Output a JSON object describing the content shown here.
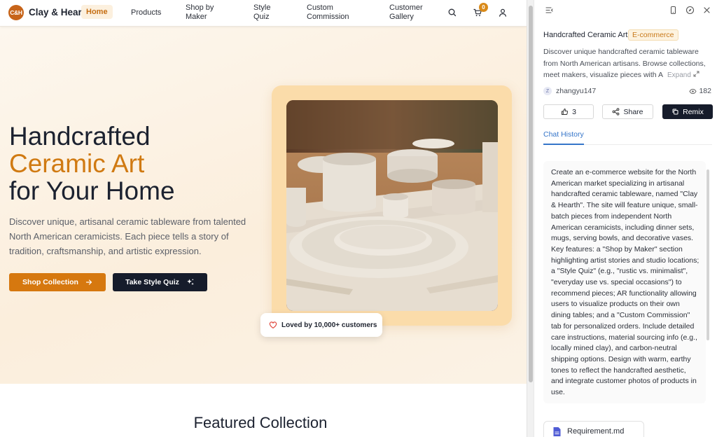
{
  "site": {
    "logo_badge": "C&H",
    "logo_text": "Clay & Hearth",
    "nav": {
      "home": "Home",
      "products": "Products",
      "shop_by_maker": "Shop by Maker",
      "style_quiz": "Style Quiz",
      "custom_commission": "Custom Commission",
      "customer_gallery": "Customer Gallery",
      "cart_count": "0"
    },
    "hero": {
      "title_line1": "Handcrafted",
      "title_line2": "Ceramic Art",
      "title_line3": "for Your Home",
      "description": "Discover unique, artisanal ceramic tableware from talented North American ceramicists. Each piece tells a story of tradition, craftsmanship, and artistic expression.",
      "shop_button": "Shop Collection",
      "quiz_button": "Take Style Quiz",
      "loved_badge": "Loved by 10,000+ customers"
    },
    "featured_title": "Featured Collection"
  },
  "panel": {
    "title": "Handcrafted Ceramic Art",
    "tag": "E-commerce",
    "description": "Discover unique handcrafted ceramic tableware from North American artisans. Browse collections, meet makers, visualize pieces with A ...",
    "expand_label": "Expand",
    "author_initial": "Z",
    "author": "zhangyu147",
    "views": "182",
    "likes": "3",
    "share_label": "Share",
    "remix_label": "Remix",
    "tab_chat_history": "Chat History",
    "chat_message": "Create an e-commerce website for the North American market specializing in artisanal handcrafted ceramic tableware, named \"Clay & Hearth\". The site will feature unique, small-batch pieces from independent North American ceramicists, including dinner sets, mugs, serving bowls, and decorative vases. Key features: a \"Shop by Maker\" section highlighting artist stories and studio locations; a \"Style Quiz\" (e.g., \"rustic vs. minimalist\", \"everyday use vs. special occasions\") to recommend pieces; AR functionality allowing users to visualize products on their own dining tables; and a \"Custom Commission\" tab for personalized orders. Include detailed care instructions, material sourcing info (e.g., locally mined clay), and carbon-neutral shipping options. Design with warm, earthy tones to reflect the handcrafted aesthetic, and integrate customer photos of products in use.",
    "file_name": "Requirement.md"
  },
  "colors": {
    "accent_orange": "#d6780f",
    "dark_navy": "#161c2b",
    "link_blue": "#3575c9"
  }
}
